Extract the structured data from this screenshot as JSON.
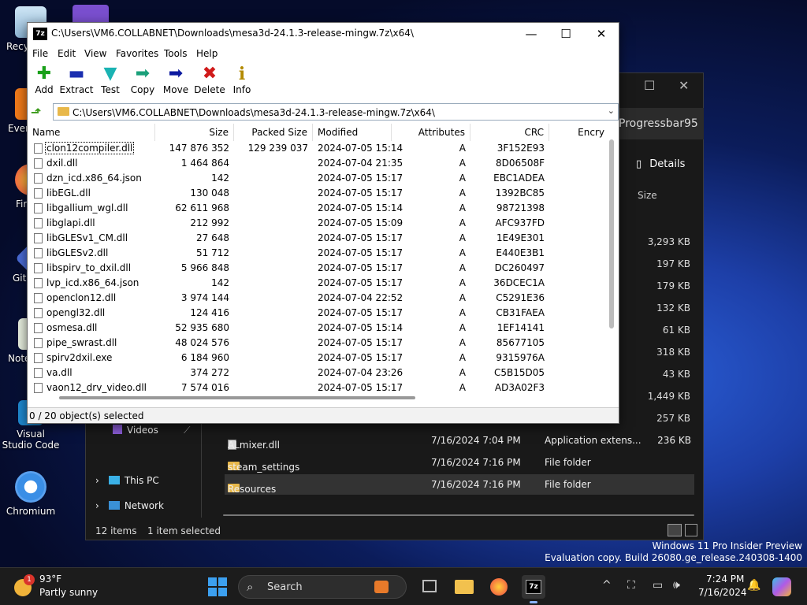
{
  "desktop": {
    "icons": [
      {
        "label": "Recy"
      },
      {
        "label": "Ever"
      },
      {
        "label": "Fir"
      },
      {
        "label": "Git"
      },
      {
        "label": "Note"
      },
      {
        "label": "Visual Studio Code"
      },
      {
        "label": "Chromium"
      }
    ],
    "watermark_line1": "Windows 11 Pro Insider Preview",
    "watermark_line2": "Evaluation copy. Build 26080.ge_release.240308-1400"
  },
  "explorer": {
    "tab_title": "Progressbar95",
    "details_label": "Details",
    "size_header": "Size",
    "sizes": [
      "3,293 KB",
      "197 KB",
      "179 KB",
      "132 KB",
      "61 KB",
      "318 KB",
      "43 KB",
      "1,449 KB",
      "257 KB"
    ],
    "rows": [
      {
        "name": "ALmixer.dll",
        "date": "7/16/2024 7:04 PM",
        "type": "Application extens...",
        "size": "236 KB"
      },
      {
        "name": "steam_settings",
        "date": "7/16/2024 7:16 PM",
        "type": "File folder",
        "size": ""
      },
      {
        "name": "Resources",
        "date": "7/16/2024 7:16 PM",
        "type": "File folder",
        "size": ""
      }
    ],
    "nav_videos": "Videos",
    "nav_this_pc": "This PC",
    "nav_network": "Network",
    "status_items": "12 items",
    "status_selected": "1 item selected"
  },
  "sevenzip": {
    "title": "C:\\Users\\VM6.COLLABNET\\Downloads\\mesa3d-24.1.3-release-mingw.7z\\x64\\",
    "menu": [
      "File",
      "Edit",
      "View",
      "Favorites",
      "Tools",
      "Help"
    ],
    "toolbar": [
      {
        "label": "Add",
        "icon": "add-icon",
        "color": "#1aa01a"
      },
      {
        "label": "Extract",
        "icon": "extract-icon",
        "color": "#1b2fb0"
      },
      {
        "label": "Test",
        "icon": "test-icon",
        "color": "#1ab3b3"
      },
      {
        "label": "Copy",
        "icon": "copy-icon",
        "color": "#1aa07a"
      },
      {
        "label": "Move",
        "icon": "move-icon",
        "color": "#0c1aa0"
      },
      {
        "label": "Delete",
        "icon": "delete-icon",
        "color": "#d01a1a"
      },
      {
        "label": "Info",
        "icon": "info-icon",
        "color": "#b38a00"
      }
    ],
    "address": "C:\\Users\\VM6.COLLABNET\\Downloads\\mesa3d-24.1.3-release-mingw.7z\\x64\\",
    "columns": {
      "name": "Name",
      "size": "Size",
      "packed": "Packed Size",
      "modified": "Modified",
      "attributes": "Attributes",
      "crc": "CRC",
      "encrypted": "Encry"
    },
    "files": [
      {
        "name": "clon12compiler.dll",
        "size": "147 876 352",
        "packed": "129 239 037",
        "modified": "2024-07-05 15:14",
        "attr": "A",
        "crc": "3F152E93"
      },
      {
        "name": "dxil.dll",
        "size": "1 464 864",
        "packed": "",
        "modified": "2024-07-04 21:35",
        "attr": "A",
        "crc": "8D06508F"
      },
      {
        "name": "dzn_icd.x86_64.json",
        "size": "142",
        "packed": "",
        "modified": "2024-07-05 15:17",
        "attr": "A",
        "crc": "EBC1ADEA"
      },
      {
        "name": "libEGL.dll",
        "size": "130 048",
        "packed": "",
        "modified": "2024-07-05 15:17",
        "attr": "A",
        "crc": "1392BC85"
      },
      {
        "name": "libgallium_wgl.dll",
        "size": "62 611 968",
        "packed": "",
        "modified": "2024-07-05 15:14",
        "attr": "A",
        "crc": "98721398"
      },
      {
        "name": "libglapi.dll",
        "size": "212 992",
        "packed": "",
        "modified": "2024-07-05 15:09",
        "attr": "A",
        "crc": "AFC937FD"
      },
      {
        "name": "libGLESv1_CM.dll",
        "size": "27 648",
        "packed": "",
        "modified": "2024-07-05 15:17",
        "attr": "A",
        "crc": "1E49E301"
      },
      {
        "name": "libGLESv2.dll",
        "size": "51 712",
        "packed": "",
        "modified": "2024-07-05 15:17",
        "attr": "A",
        "crc": "E440E3B1"
      },
      {
        "name": "libspirv_to_dxil.dll",
        "size": "5 966 848",
        "packed": "",
        "modified": "2024-07-05 15:17",
        "attr": "A",
        "crc": "DC260497"
      },
      {
        "name": "lvp_icd.x86_64.json",
        "size": "142",
        "packed": "",
        "modified": "2024-07-05 15:17",
        "attr": "A",
        "crc": "36DCEC1A"
      },
      {
        "name": "openclon12.dll",
        "size": "3 974 144",
        "packed": "",
        "modified": "2024-07-04 22:52",
        "attr": "A",
        "crc": "C5291E36"
      },
      {
        "name": "opengl32.dll",
        "size": "124 416",
        "packed": "",
        "modified": "2024-07-05 15:17",
        "attr": "A",
        "crc": "CB31FAEA"
      },
      {
        "name": "osmesa.dll",
        "size": "52 935 680",
        "packed": "",
        "modified": "2024-07-05 15:14",
        "attr": "A",
        "crc": "1EF14141"
      },
      {
        "name": "pipe_swrast.dll",
        "size": "48 024 576",
        "packed": "",
        "modified": "2024-07-05 15:17",
        "attr": "A",
        "crc": "85677105"
      },
      {
        "name": "spirv2dxil.exe",
        "size": "6 184 960",
        "packed": "",
        "modified": "2024-07-05 15:17",
        "attr": "A",
        "crc": "9315976A"
      },
      {
        "name": "va.dll",
        "size": "374 272",
        "packed": "",
        "modified": "2024-07-04 23:26",
        "attr": "A",
        "crc": "C5B15D05"
      },
      {
        "name": "vaon12_drv_video.dll",
        "size": "7 574 016",
        "packed": "",
        "modified": "2024-07-05 15:17",
        "attr": "A",
        "crc": "AD3A02F3"
      }
    ],
    "status": "0 / 20 object(s) selected"
  },
  "taskbar": {
    "temp": "93°F",
    "weather": "Partly sunny",
    "badge": "1",
    "search_label": "Search",
    "time": "7:24 PM",
    "date": "7/16/2024"
  }
}
